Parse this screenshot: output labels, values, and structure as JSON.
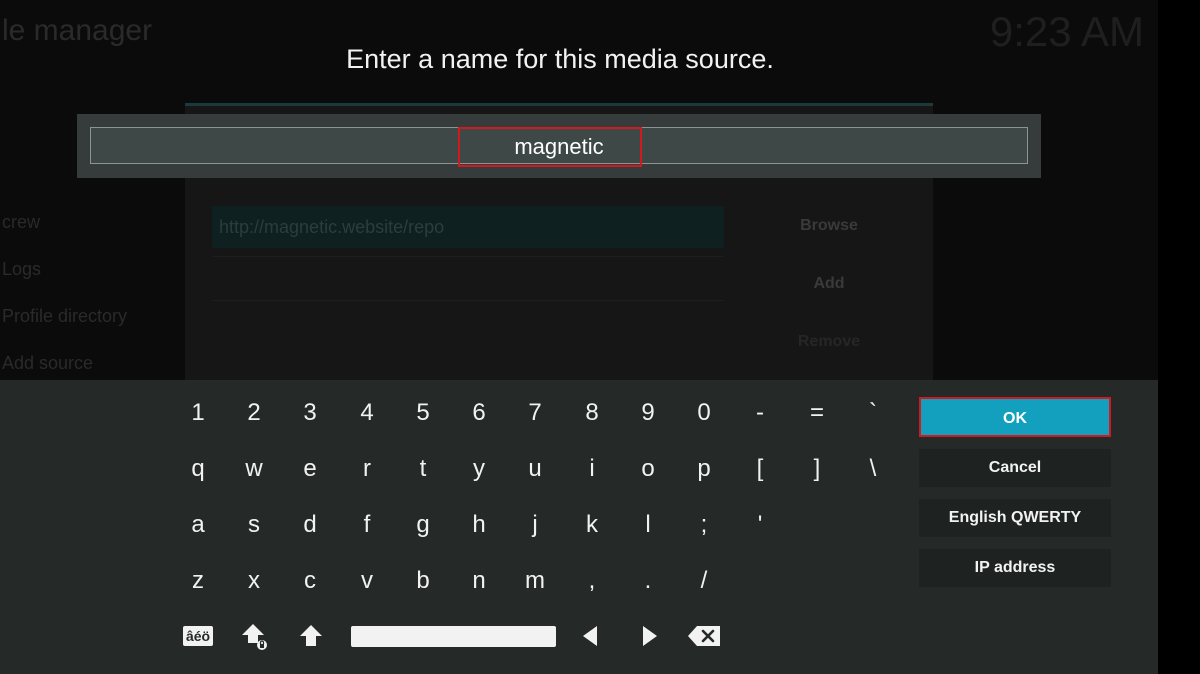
{
  "background": {
    "title": "le manager",
    "clock": "9:23 AM",
    "sidebar_items": [
      "crew",
      "Logs",
      "Profile directory",
      "Add source"
    ],
    "source_path": "http://magnetic.website/repo",
    "buttons": [
      "Browse",
      "Add",
      "Remove"
    ]
  },
  "dialog": {
    "heading": "Enter a name for this media source.",
    "input_value": "magnetic"
  },
  "keyboard": {
    "rows": [
      [
        "1",
        "2",
        "3",
        "4",
        "5",
        "6",
        "7",
        "8",
        "9",
        "0",
        "-",
        "=",
        "`"
      ],
      [
        "q",
        "w",
        "e",
        "r",
        "t",
        "y",
        "u",
        "i",
        "o",
        "p",
        "[",
        "]",
        "\\"
      ],
      [
        "a",
        "s",
        "d",
        "f",
        "g",
        "h",
        "j",
        "k",
        "l",
        ";",
        "'"
      ],
      [
        "z",
        "x",
        "c",
        "v",
        "b",
        "n",
        "m",
        ",",
        ".",
        "/"
      ]
    ],
    "symbols_label": "âéö",
    "icons": {
      "caps_lock": "caps-lock-icon",
      "shift": "shift-icon",
      "left": "arrow-left-icon",
      "right": "arrow-right-icon",
      "backspace": "backspace-icon"
    }
  },
  "side_buttons": {
    "ok": "OK",
    "cancel": "Cancel",
    "layout": "English QWERTY",
    "ip": "IP address"
  },
  "colors": {
    "accent": "#12a0be",
    "highlight": "#d01a1f",
    "panel": "#252a29"
  }
}
